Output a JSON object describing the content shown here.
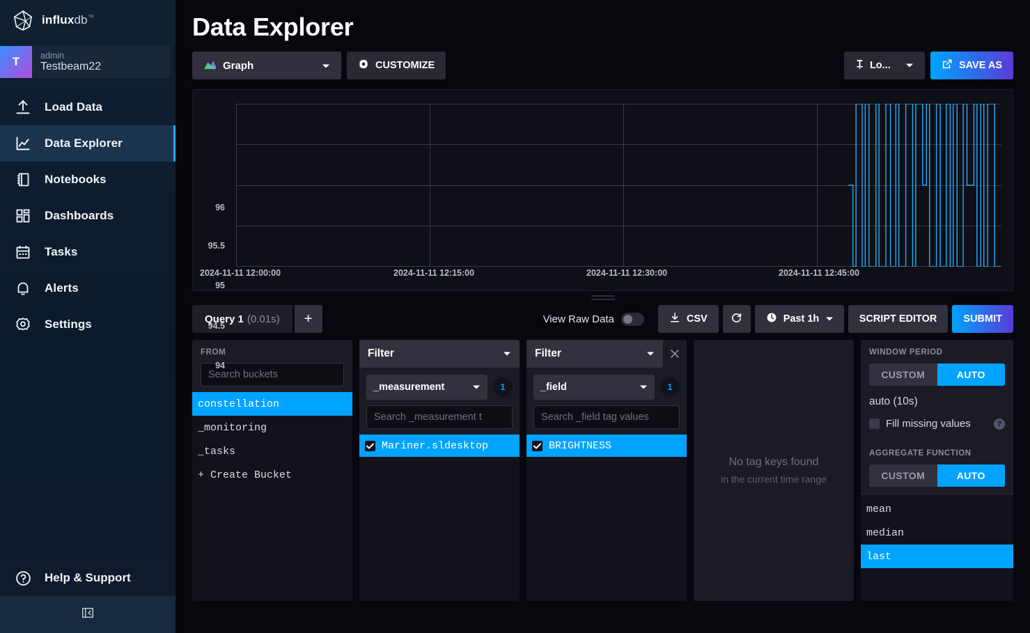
{
  "sidebar": {
    "logo": {
      "bold": "influx",
      "light": "db",
      "tm": "™",
      "icon": "influxdb-logo-icon"
    },
    "user": {
      "initial": "T",
      "role": "admin",
      "name": "Testbeam22"
    },
    "items": [
      {
        "label": "Load Data",
        "icon": "upload-icon",
        "active": false
      },
      {
        "label": "Data Explorer",
        "icon": "line-chart-icon",
        "active": true
      },
      {
        "label": "Notebooks",
        "icon": "notebook-icon",
        "active": false
      },
      {
        "label": "Dashboards",
        "icon": "dashboard-grid-icon",
        "active": false
      },
      {
        "label": "Tasks",
        "icon": "calendar-icon",
        "active": false
      },
      {
        "label": "Alerts",
        "icon": "bell-icon",
        "active": false
      },
      {
        "label": "Settings",
        "icon": "gear-icon",
        "active": false
      }
    ],
    "help": {
      "label": "Help & Support",
      "icon": "question-circle-icon"
    },
    "collapse": {
      "icon": "collapse-panel-icon"
    }
  },
  "header": {
    "title": "Data Explorer",
    "viz_dropdown": {
      "label": "Graph",
      "icon": "graph-type-icon"
    },
    "customize": {
      "label": "CUSTOMIZE",
      "icon": "gear-icon"
    },
    "locality": {
      "label": "Lo...",
      "icon": "pin-icon"
    },
    "save_as": {
      "label": "SAVE AS",
      "icon": "external-link-icon"
    }
  },
  "chart_data": {
    "type": "line",
    "title": "",
    "xlabel": "",
    "ylabel": "",
    "ylim": [
      94,
      96
    ],
    "yticks": [
      "96",
      "95.5",
      "95",
      "94.5",
      "94"
    ],
    "ytick_values": [
      96,
      95.5,
      95,
      94.5,
      94
    ],
    "xticks": [
      "2024-11-11 12:00:00",
      "2024-11-11 12:15:00",
      "2024-11-11 12:30:00",
      "2024-11-11 12:45:00"
    ],
    "xtick_fracs": [
      0.0,
      0.253,
      0.506,
      0.759
    ],
    "grid": true,
    "legend": "none",
    "line_color": "#22adf6",
    "series": [
      {
        "name": "BRIGHTNESS",
        "x": [
          0.8,
          0.806,
          0.806,
          0.81,
          0.81,
          0.818,
          0.818,
          0.822,
          0.822,
          0.827,
          0.827,
          0.836,
          0.836,
          0.84,
          0.84,
          0.849,
          0.849,
          0.855,
          0.855,
          0.862,
          0.862,
          0.866,
          0.866,
          0.875,
          0.875,
          0.884,
          0.884,
          0.888,
          0.888,
          0.897,
          0.897,
          0.902,
          0.902,
          0.906,
          0.906,
          0.915,
          0.915,
          0.92,
          0.92,
          0.928,
          0.928,
          0.933,
          0.933,
          0.937,
          0.937,
          0.942,
          0.942,
          0.95,
          0.95,
          0.955,
          0.955,
          0.964,
          0.964,
          0.968,
          0.968,
          0.973,
          0.973,
          0.977,
          0.977,
          0.982,
          0.982,
          0.991,
          0.991,
          1.0
        ],
        "y": [
          95.0,
          95.0,
          94.0,
          94.0,
          96.0,
          96.0,
          94.0,
          94.0,
          96.0,
          96.0,
          94.0,
          94.0,
          96.0,
          96.0,
          94.0,
          94.0,
          96.0,
          96.0,
          94.0,
          94.0,
          96.0,
          96.0,
          94.0,
          94.0,
          96.0,
          96.0,
          94.0,
          94.0,
          96.0,
          96.0,
          95.0,
          95.0,
          96.0,
          96.0,
          94.0,
          94.0,
          96.0,
          96.0,
          94.0,
          94.0,
          96.0,
          96.0,
          94.0,
          94.0,
          96.0,
          96.0,
          94.0,
          94.0,
          96.0,
          96.0,
          95.0,
          95.0,
          96.0,
          96.0,
          94.0,
          94.0,
          96.0,
          96.0,
          94.0,
          94.0,
          96.0,
          96.0,
          94.0,
          94.0
        ]
      }
    ]
  },
  "query_bar": {
    "tab_label": "Query 1",
    "tab_duration": "(0.01s)",
    "add_label": "+",
    "raw_data_label": "View Raw Data",
    "raw_data_on": false,
    "csv_label": "CSV",
    "csv_icon": "download-icon",
    "refresh_icon": "refresh-icon",
    "time_range": "Past 1h",
    "time_icon": "clock-icon",
    "script_editor_label": "SCRIPT EDITOR",
    "submit_label": "SUBMIT"
  },
  "builder": {
    "from": {
      "title": "FROM",
      "search_placeholder": "Search buckets",
      "search_value": "",
      "buckets": [
        "constellation",
        "_monitoring",
        "_tasks"
      ],
      "selected_bucket": "constellation",
      "create_label": "+ Create Bucket"
    },
    "filter1": {
      "header_label": "Filter",
      "key": "_measurement",
      "count": "1",
      "search_placeholder": "Search _measurement t",
      "search_value": "",
      "values": [
        "Mariner.sldesktop"
      ],
      "selected": [
        "Mariner.sldesktop"
      ]
    },
    "filter2": {
      "header_label": "Filter",
      "key": "_field",
      "count": "1",
      "search_placeholder": "Search _field tag values",
      "search_value": "",
      "values": [
        "BRIGHTNESS"
      ],
      "selected": [
        "BRIGHTNESS"
      ],
      "close_icon": "close-icon"
    },
    "tagkeys": {
      "empty_line1": "No tag keys found",
      "empty_line2": "in the current time range"
    },
    "right": {
      "window_title": "WINDOW PERIOD",
      "window_custom": "CUSTOM",
      "window_auto": "AUTO",
      "window_selected": "AUTO",
      "window_value": "auto (10s)",
      "fill_label": "Fill missing values",
      "fill_checked": false,
      "help_icon": "question-mark-icon",
      "agg_title": "AGGREGATE FUNCTION",
      "agg_custom": "CUSTOM",
      "agg_auto": "AUTO",
      "agg_selected": "AUTO",
      "functions": [
        "mean",
        "median",
        "last"
      ],
      "selected_function": "last"
    }
  },
  "colors": {
    "accent": "#00a3ff",
    "line": "#22adf6",
    "sidebar_active": "#19344c",
    "panel": "#1b1b26"
  }
}
